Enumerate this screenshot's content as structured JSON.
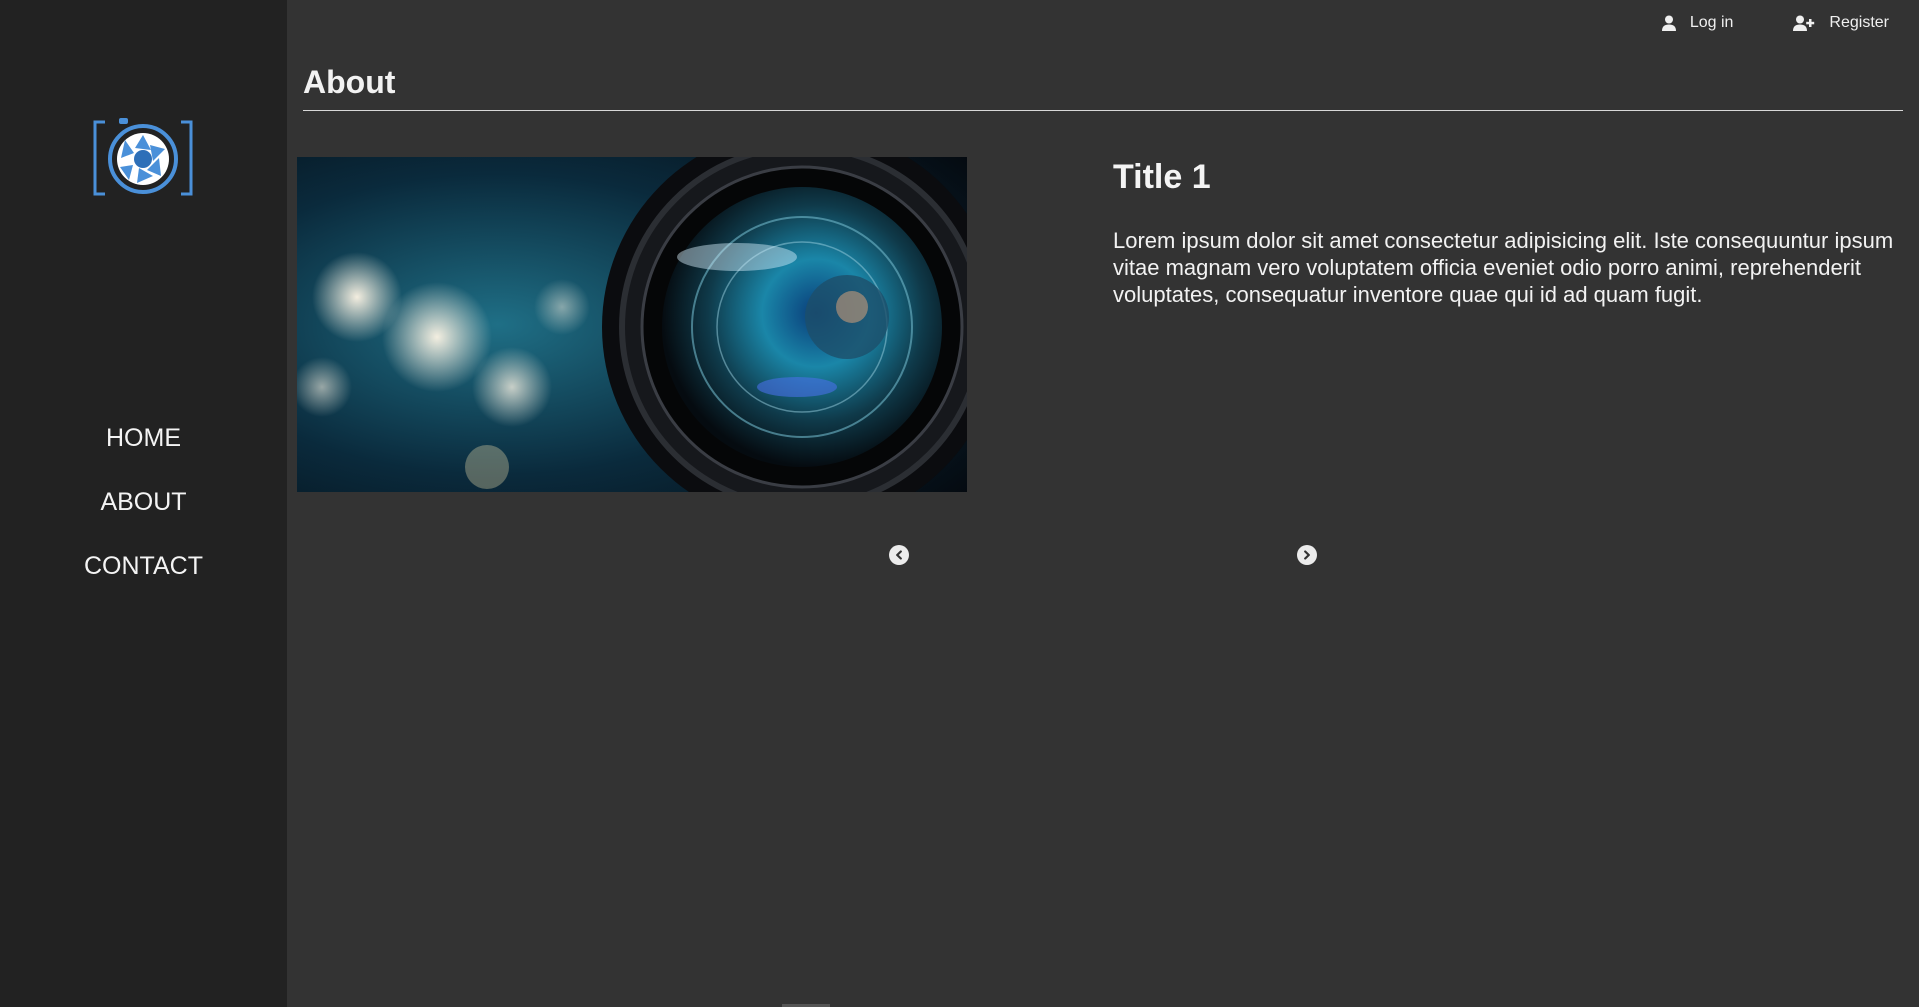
{
  "sidebar": {
    "logo_icon": "camera-aperture-icon",
    "nav_items": [
      {
        "label": "HOME"
      },
      {
        "label": "ABOUT"
      },
      {
        "label": "CONTACT"
      }
    ]
  },
  "topbar": {
    "login": {
      "icon": "user-icon",
      "label": "Log in"
    },
    "register": {
      "icon": "user-plus-icon",
      "label": "Register"
    }
  },
  "page": {
    "title": "About"
  },
  "carousel": {
    "image": "camera-lens-photo",
    "slide_title": "Title 1",
    "slide_text": "Lorem ipsum dolor sit amet consectetur adipisicing elit. Iste consequuntur ipsum vitae magnam vero voluptatem officia eveniet odio porro animi, reprehenderit voluptates, consequatur inventore quae qui id ad quam fugit.",
    "prev_icon": "chevron-left-circle-icon",
    "next_icon": "chevron-right-circle-icon"
  },
  "colors": {
    "page_background": "#333333",
    "sidebar_background": "#222222",
    "logo_accent": "#4a90d9",
    "text": "#f0f0f0"
  }
}
